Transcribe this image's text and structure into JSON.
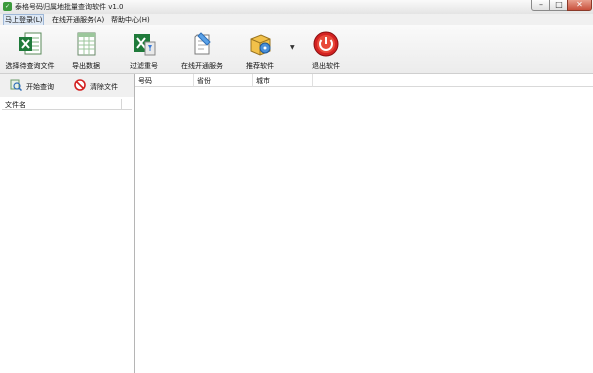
{
  "window": {
    "title": "泰格号码归属地批量查询软件 v1.0",
    "app_icon_glyph": "✓",
    "controls": {
      "minimize": "–",
      "maximize": "□",
      "close": "✕"
    }
  },
  "menu": [
    {
      "label": "马上登录(L)"
    },
    {
      "label": "在线开通服务(A)"
    },
    {
      "label": "帮助中心(H)"
    }
  ],
  "toolbar": {
    "items": [
      {
        "label": "选择待查询文件",
        "icon": "excel-icon"
      },
      {
        "label": "导出数据",
        "icon": "spreadsheet-icon"
      },
      {
        "label": "过滤重号",
        "icon": "filter-icon"
      },
      {
        "label": "在线开通服务",
        "icon": "online-service-icon"
      },
      {
        "label": "推荐软件",
        "icon": "software-box-icon"
      },
      {
        "label": "退出软件",
        "icon": "power-icon"
      }
    ],
    "dropdown_glyph": "▼"
  },
  "left_panel": {
    "start_button": "开始查询",
    "clear_button": "清除文件",
    "column_header": "文件名"
  },
  "results_table": {
    "columns": [
      "号码",
      "省份",
      "城市"
    ]
  },
  "colors": {
    "excel_green": "#1f7a3a",
    "power_red": "#d42222",
    "close_button": "#c8503c"
  }
}
